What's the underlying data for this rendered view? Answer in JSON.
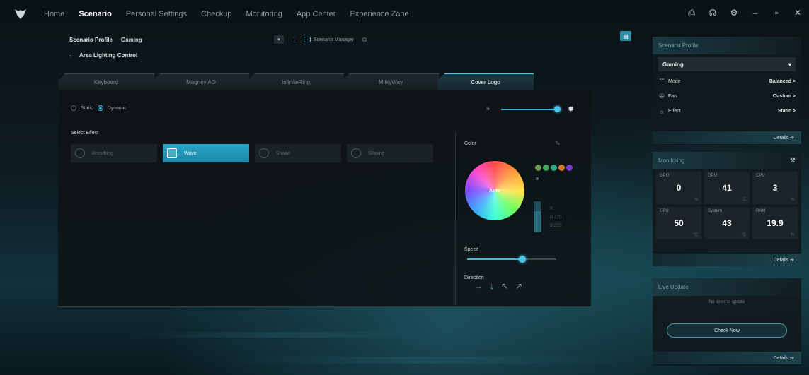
{
  "nav": {
    "items": [
      "Home",
      "Scenario",
      "Personal Settings",
      "Checkup",
      "Monitoring",
      "App Center",
      "Experience Zone"
    ],
    "active_index": 1
  },
  "topbar_icons": [
    "disk-icon",
    "headset-icon",
    "settings-icon",
    "minimize-icon",
    "restore-icon",
    "close-icon"
  ],
  "topbar_glyphs": [
    "⎙",
    "☊",
    "⚙",
    "–",
    "▫",
    "✕"
  ],
  "profile": {
    "label": "Scenario Profile",
    "value": "Gaming",
    "manager_label": "Scenario Manager",
    "back_label": "Area Lighting Control"
  },
  "tabs": [
    "Keyboard",
    "Magney AO",
    "InfiniteRing",
    "MilkyWay",
    "Cover Logo"
  ],
  "active_tab": 4,
  "mode": {
    "static_label": "Static",
    "dynamic_label": "Dynamic",
    "selected": "Dynamic"
  },
  "brightness": {
    "level": 0.92
  },
  "effects": {
    "label": "Select Effect",
    "items": [
      "Breathing",
      "Wave",
      "Snake",
      "Sloping"
    ],
    "active_index": 1
  },
  "color": {
    "label": "Color",
    "wheel_label": "Auto",
    "swatches": [
      "#6a9a4a",
      "#3fa85a",
      "#2fa87a",
      "#d67a2a",
      "#7a3ad6"
    ],
    "rgb_lines": [
      "R",
      "G  175",
      "B  255"
    ]
  },
  "speed": {
    "label": "Speed",
    "level": 0.62
  },
  "direction": {
    "label": "Direction",
    "arrows": [
      "→",
      "↓",
      "↖",
      "↗"
    ],
    "arrow_names": [
      "right-arrow-icon",
      "down-arrow-icon",
      "up-left-arrow-icon",
      "up-right-arrow-icon"
    ],
    "active_index": 1
  },
  "sidebar": {
    "scenario_profile": {
      "title": "Scenario Profile",
      "select_value": "Gaming",
      "rows": [
        {
          "label": "Mode",
          "value": "Balanced >",
          "icon": "mode-icon",
          "glyph": "☷"
        },
        {
          "label": "Fan",
          "value": "Custom >",
          "icon": "fan-icon",
          "glyph": "✇"
        },
        {
          "label": "Effect",
          "value": "Static >",
          "icon": "effect-icon",
          "glyph": "☼"
        }
      ],
      "details": "Details ➔"
    },
    "monitoring": {
      "title": "Monitoring",
      "cells": [
        {
          "label": "GPU",
          "value": "0",
          "unit": "%"
        },
        {
          "label": "GPU",
          "value": "41",
          "unit": "°C"
        },
        {
          "label": "CPU",
          "value": "3",
          "unit": "%"
        },
        {
          "label": "CPU",
          "value": "50",
          "unit": "°C"
        },
        {
          "label": "System",
          "value": "43",
          "unit": "°C"
        },
        {
          "label": "RAM",
          "value": "19.9",
          "unit": "%"
        }
      ],
      "details": "Details ➔"
    },
    "live_update": {
      "title": "Live Update",
      "empty_text": "No items to update",
      "button": "Check Now",
      "details": "Details ➔"
    }
  }
}
